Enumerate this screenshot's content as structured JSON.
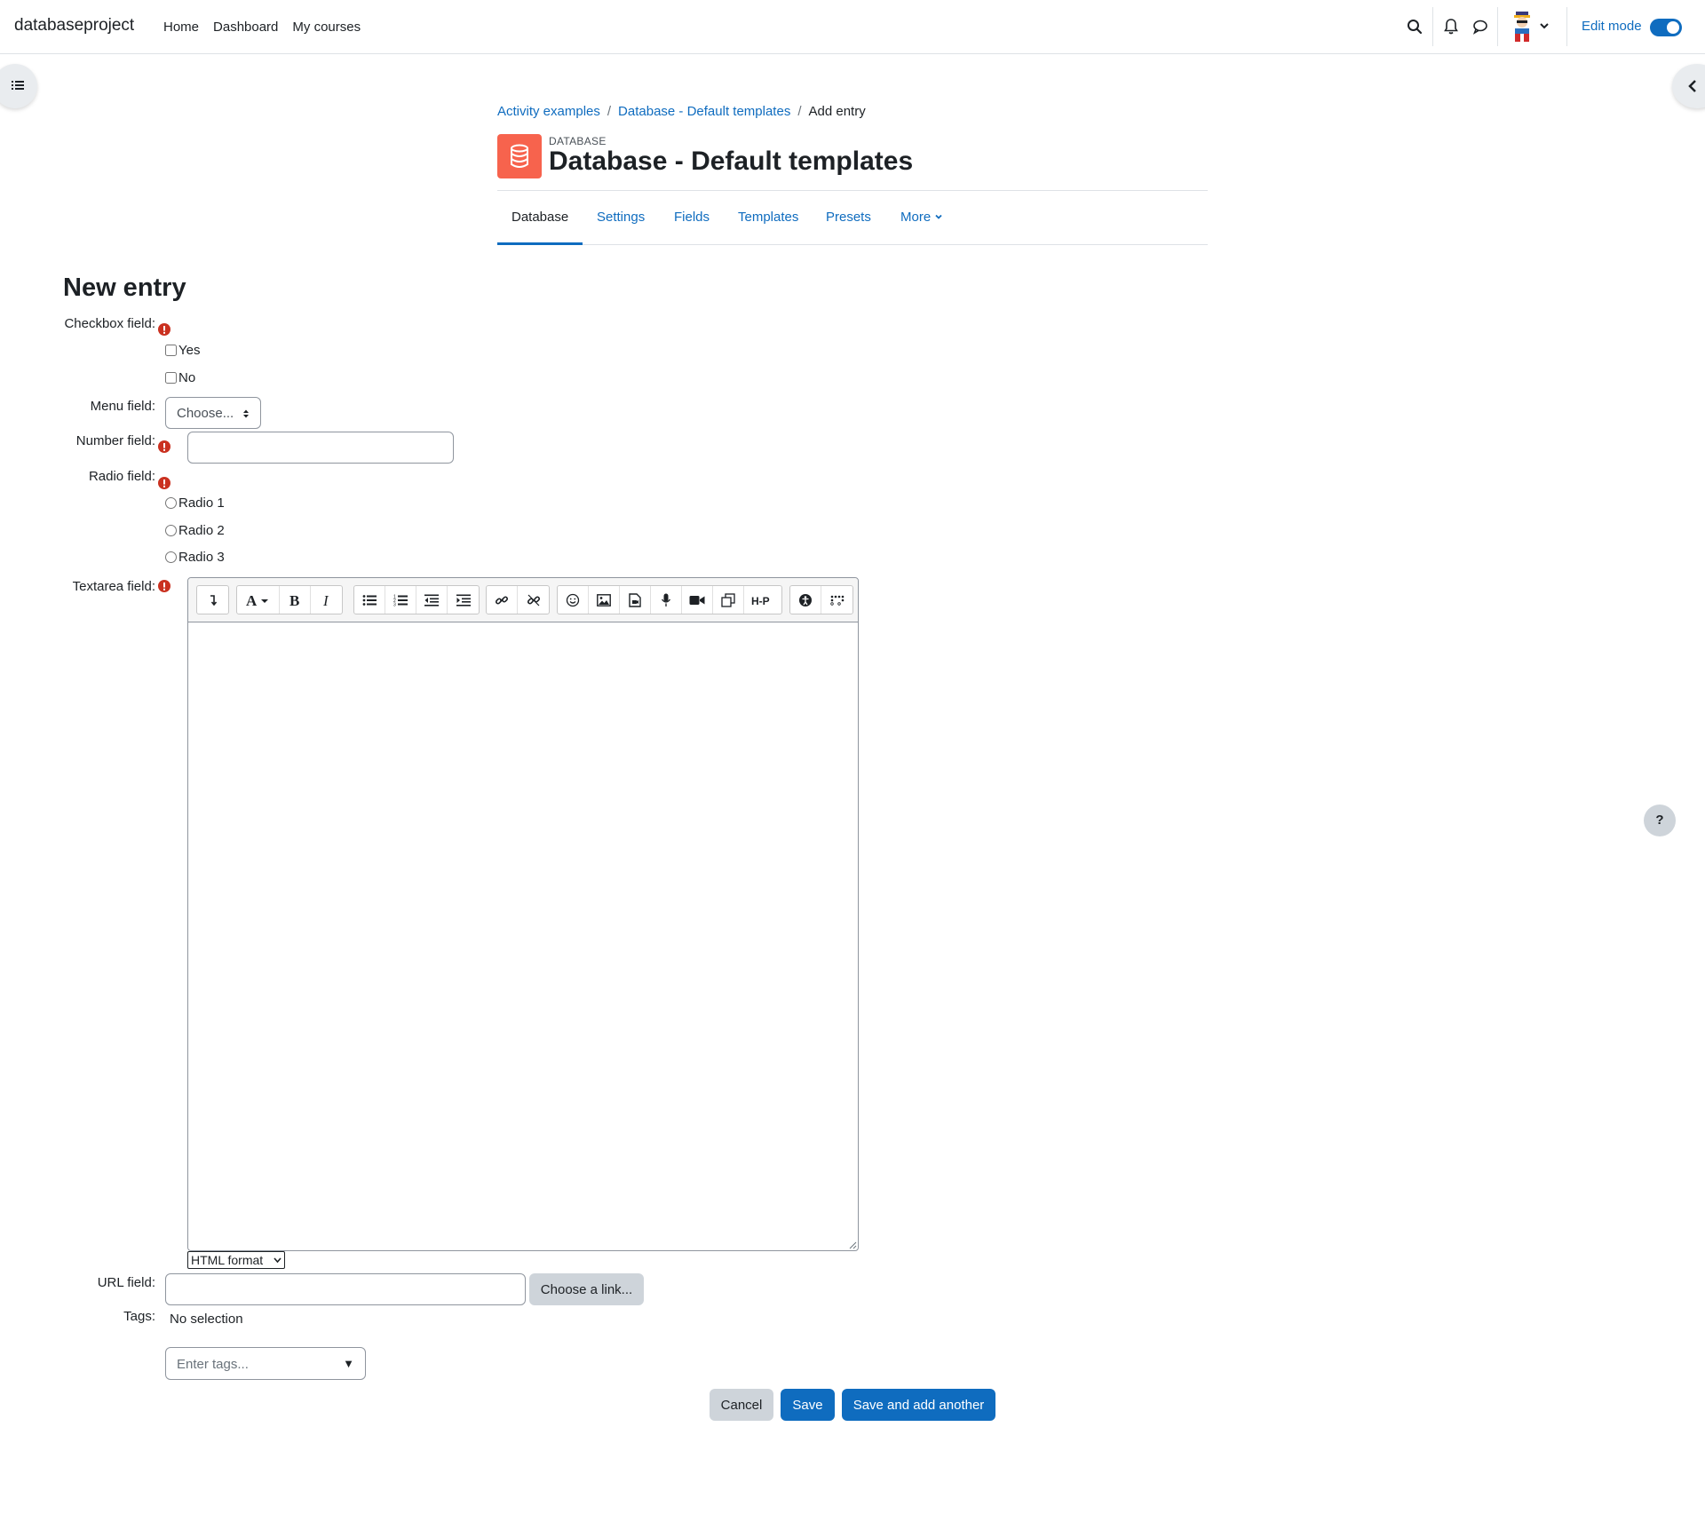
{
  "app": {
    "site_name": "databaseproject",
    "nav": [
      "Home",
      "Dashboard",
      "My courses"
    ],
    "edit_mode_label": "Edit mode",
    "accent_color": "#0f6cbf"
  },
  "breadcrumb": [
    "Activity examples",
    "Database - Default templates",
    "Add entry"
  ],
  "header": {
    "activity_type": "DATABASE",
    "title": "Database - Default templates",
    "activity_icon": "database-icon",
    "activity_icon_color": "#f7634d"
  },
  "tabs": [
    "Database",
    "Settings",
    "Fields",
    "Templates",
    "Presets",
    "More"
  ],
  "form": {
    "heading": "New entry",
    "checkbox_label": "Checkbox field:",
    "checkbox_options": [
      "Yes",
      "No"
    ],
    "menu_label": "Menu field:",
    "menu_value": "Choose...",
    "number_label": "Number field:",
    "number_value": "",
    "radio_label": "Radio field:",
    "radio_options": [
      "Radio 1",
      "Radio 2",
      "Radio 3"
    ],
    "textarea_label": "Textarea field:",
    "format_value": "HTML format",
    "url_label": "URL field:",
    "url_value": "",
    "choose_link_label": "Choose a link...",
    "tags_label": "Tags:",
    "tags_selection": "No selection",
    "tags_placeholder": "Enter tags..."
  },
  "buttons": {
    "cancel": "Cancel",
    "save": "Save",
    "save_and_add": "Save and add another"
  },
  "help_label": "?"
}
